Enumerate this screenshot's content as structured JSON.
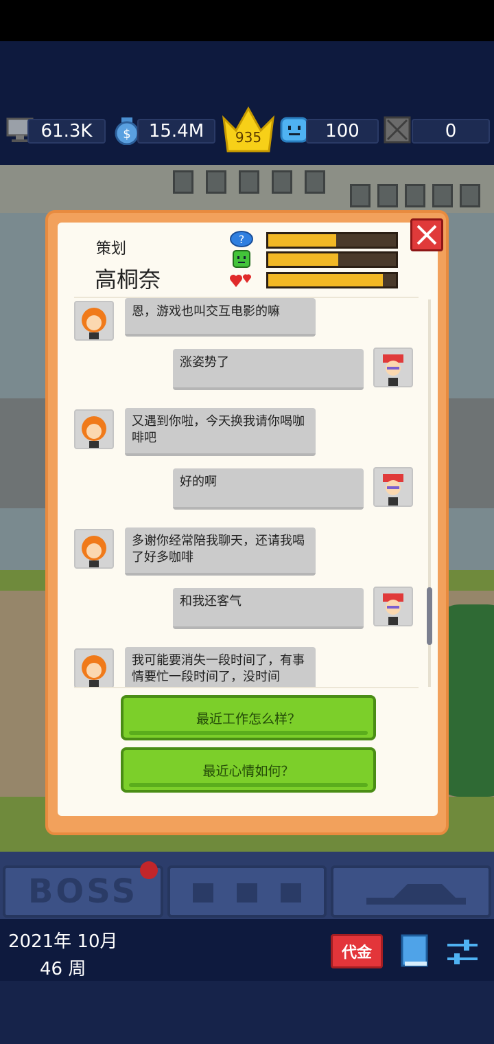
{
  "stats": {
    "computers": "61.3K",
    "money": "15.4M",
    "crown_level": "935",
    "fans": "100",
    "bugs": "0"
  },
  "dialog": {
    "role": "策划",
    "name": "高桐奈",
    "bars": [
      {
        "icon": "question-icon",
        "level": 0.53,
        "color": "#f2b825"
      },
      {
        "icon": "smile-icon",
        "level": 0.55,
        "color": "#f2b825"
      },
      {
        "icon": "hearts-icon",
        "level": 0.9,
        "color": "#f2b825"
      }
    ],
    "messages": [
      {
        "from": "npc",
        "text": "恩，游戏也叫交互电影的嘛"
      },
      {
        "from": "player",
        "text": "涨姿势了"
      },
      {
        "from": "npc",
        "text": "又遇到你啦，今天换我请你喝咖啡吧"
      },
      {
        "from": "player",
        "text": "好的啊"
      },
      {
        "from": "npc",
        "text": "多谢你经常陪我聊天，还请我喝了好多咖啡"
      },
      {
        "from": "player",
        "text": "和我还客气"
      },
      {
        "from": "npc",
        "text": "我可能要消失一段时间了，有事情要忙一段时间了，没时间"
      }
    ],
    "choices": [
      "最近工作怎么样？",
      "最近心情如何？"
    ]
  },
  "dock": {
    "boss_label": "BOSS"
  },
  "footer": {
    "date_line1": "2021年 10月",
    "date_line2": "46 周",
    "coupon_label": "代金"
  },
  "colors": {
    "navy": "#0e1a3e",
    "dialog_orange": "#f2a15c",
    "choice_green": "#7ccf2a",
    "bar_fill": "#f2b825",
    "close_red": "#e03a3a"
  }
}
